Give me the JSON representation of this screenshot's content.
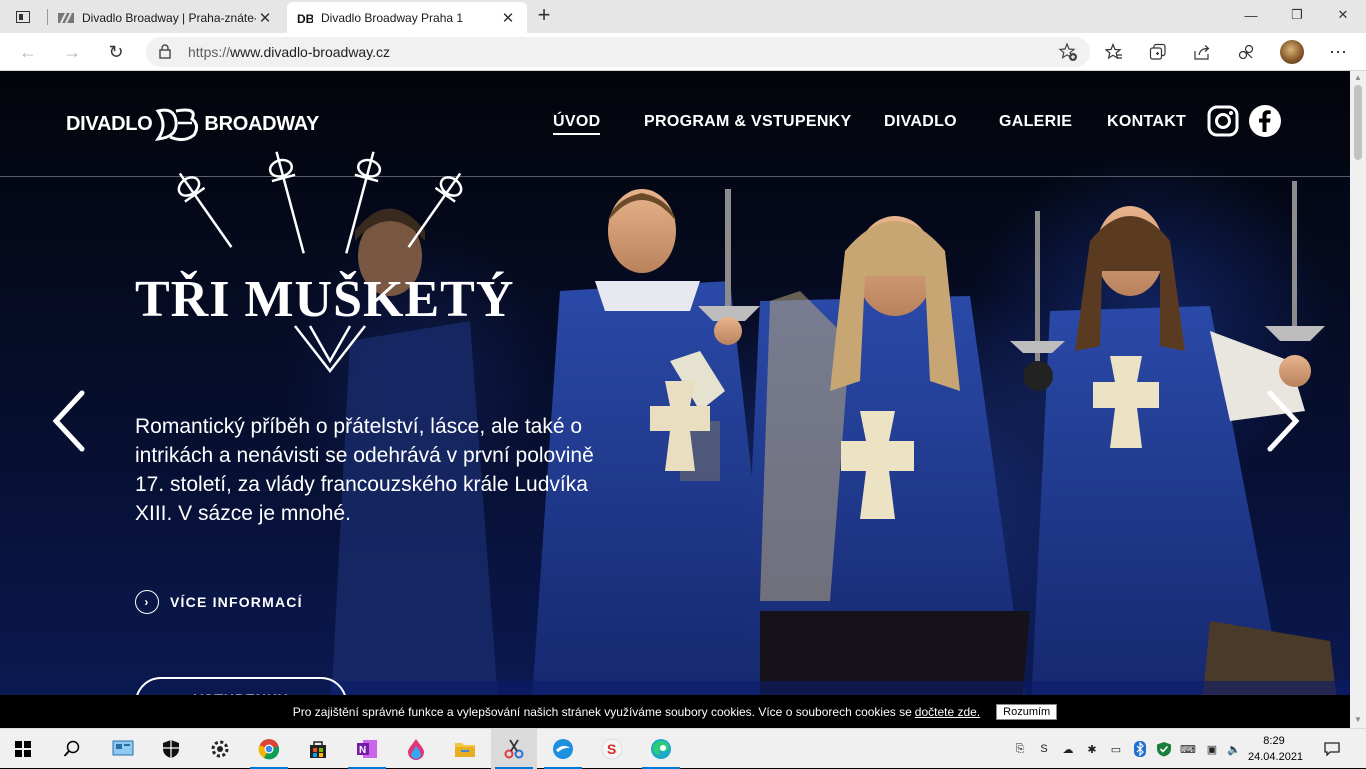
{
  "browser": {
    "tabs": [
      {
        "title": "Divadlo Broadway | Praha-znáte-",
        "active": false
      },
      {
        "title": "Divadlo Broadway Praha 1",
        "active": true
      }
    ],
    "url_scheme": "https://",
    "url_host": "www.divadlo-broadway.cz"
  },
  "site": {
    "logo_left": "DIVADLO",
    "logo_right": "BROADWAY",
    "nav": [
      {
        "label": "ÚVOD",
        "active": true
      },
      {
        "label": "PROGRAM & VSTUPENKY",
        "active": false
      },
      {
        "label": "DIVADLO",
        "active": false
      },
      {
        "label": "GALERIE",
        "active": false
      },
      {
        "label": "KONTAKT",
        "active": false
      }
    ]
  },
  "hero": {
    "show_title": "TŘI MUŠKETÝŘI",
    "description": "Romantický příběh o přátelství, lásce, ale také o intrikách a nenávisti se odehrává v první polovině 17. století, za vlády francouzského krále Ludvíka XIII. V sázce je mnohé.",
    "more_label": "VÍCE INFORMACÍ",
    "button_label": "VSTUPENKY"
  },
  "cookie_bar": {
    "text": "Pro zajištění správné funkce a vylepšování našich stránek využíváme soubory cookies. Více o souborech cookies se",
    "link": "dočtete zde.",
    "button": "Rozumím"
  },
  "taskbar": {
    "time": "8:29",
    "date": "24.04.2021"
  },
  "colors": {
    "costume_blue": "#1f3a8a",
    "taskbar_accent": "#0078d7"
  }
}
